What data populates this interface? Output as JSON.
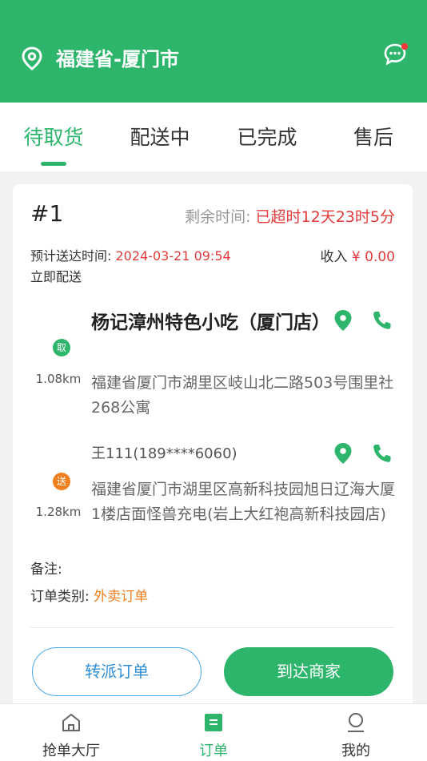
{
  "header": {
    "location_icon": "map-pin-icon",
    "city": "福建省-厦门市",
    "message_icon": "chat-bubble-icon",
    "notification_dot": true
  },
  "tabs": [
    {
      "label": "待取货",
      "active": true
    },
    {
      "label": "配送中",
      "active": false
    },
    {
      "label": "已完成",
      "active": false
    },
    {
      "label": "售后",
      "active": false
    }
  ],
  "order": {
    "number": "#1",
    "remaining_label": "剩余时间:",
    "remaining_value": "已超时12天23时5分",
    "eta_label": "预计送达时间:",
    "eta_value": "2024-03-21 09:54",
    "income_label": "收入",
    "income_value": "¥ 0.00",
    "delivery_type": "立即配送",
    "pickup": {
      "badge": "取",
      "distance": "1.08km",
      "shop_name": "杨记漳州特色小吃（厦门店）",
      "address": "福建省厦门市湖里区岐山北二路503号围里社268公寓"
    },
    "dropoff": {
      "badge": "送",
      "distance": "1.28km",
      "recipient": "王111(189****6060)",
      "address": "福建省厦门市湖里区高新科技园旭日辽海大厦1楼店面怪兽充电(岩上大红袍高新科技园店)"
    },
    "note_label": "备注:",
    "type_label": "订单类别:",
    "type_value": "外卖订单",
    "buttons": {
      "transfer": "转派订单",
      "arrive": "到达商家"
    }
  },
  "bottom_nav": [
    {
      "label": "抢单大厅",
      "icon": "home-icon",
      "active": false
    },
    {
      "label": "订单",
      "icon": "order-list-icon",
      "active": true
    },
    {
      "label": "我的",
      "icon": "user-icon",
      "active": false
    }
  ],
  "colors": {
    "primary": "#2db66b",
    "alert": "#e23b3b",
    "accent_orange": "#f07f1e",
    "outline_blue": "#4aa8e8"
  }
}
